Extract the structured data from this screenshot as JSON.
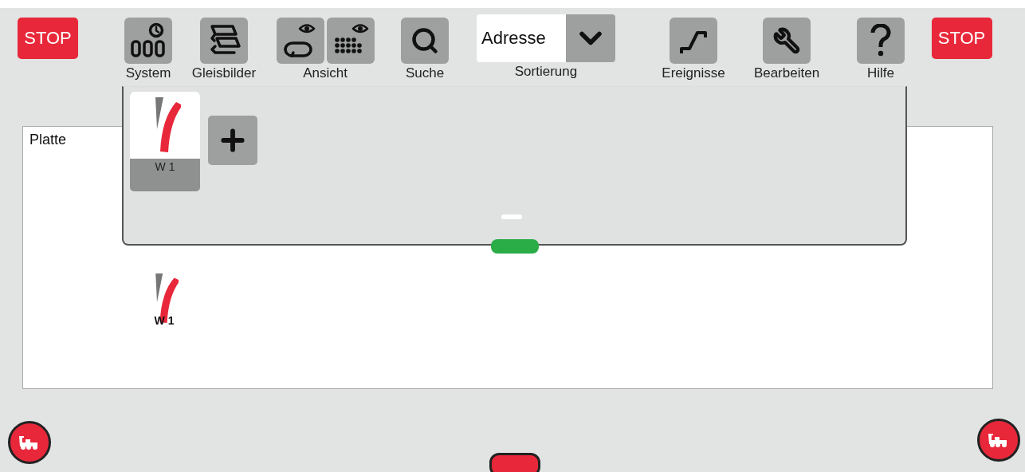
{
  "toolbar": [
    {
      "kind": "stop",
      "label": "STOP"
    },
    {
      "kind": "tool",
      "label": "System"
    },
    {
      "kind": "tool",
      "label": "Gleisbilder"
    },
    {
      "kind": "tool",
      "label": "Ansicht"
    },
    {
      "kind": "tool",
      "label": "Suche"
    },
    {
      "kind": "select",
      "value": "Adresse",
      "label": "Sortierung"
    },
    {
      "kind": "tool",
      "label": "Ereignisse"
    },
    {
      "kind": "tool",
      "label": "Bearbeiten"
    },
    {
      "kind": "tool",
      "label": "Hilfe"
    },
    {
      "kind": "stop",
      "label": "STOP"
    }
  ],
  "switch_panel": {
    "tiles": [
      {
        "kind": "switch",
        "label": "W 1"
      },
      {
        "kind": "add"
      }
    ]
  },
  "board": {
    "title": "Platte",
    "items": [
      {
        "kind": "switch",
        "label": "W 1"
      }
    ]
  }
}
